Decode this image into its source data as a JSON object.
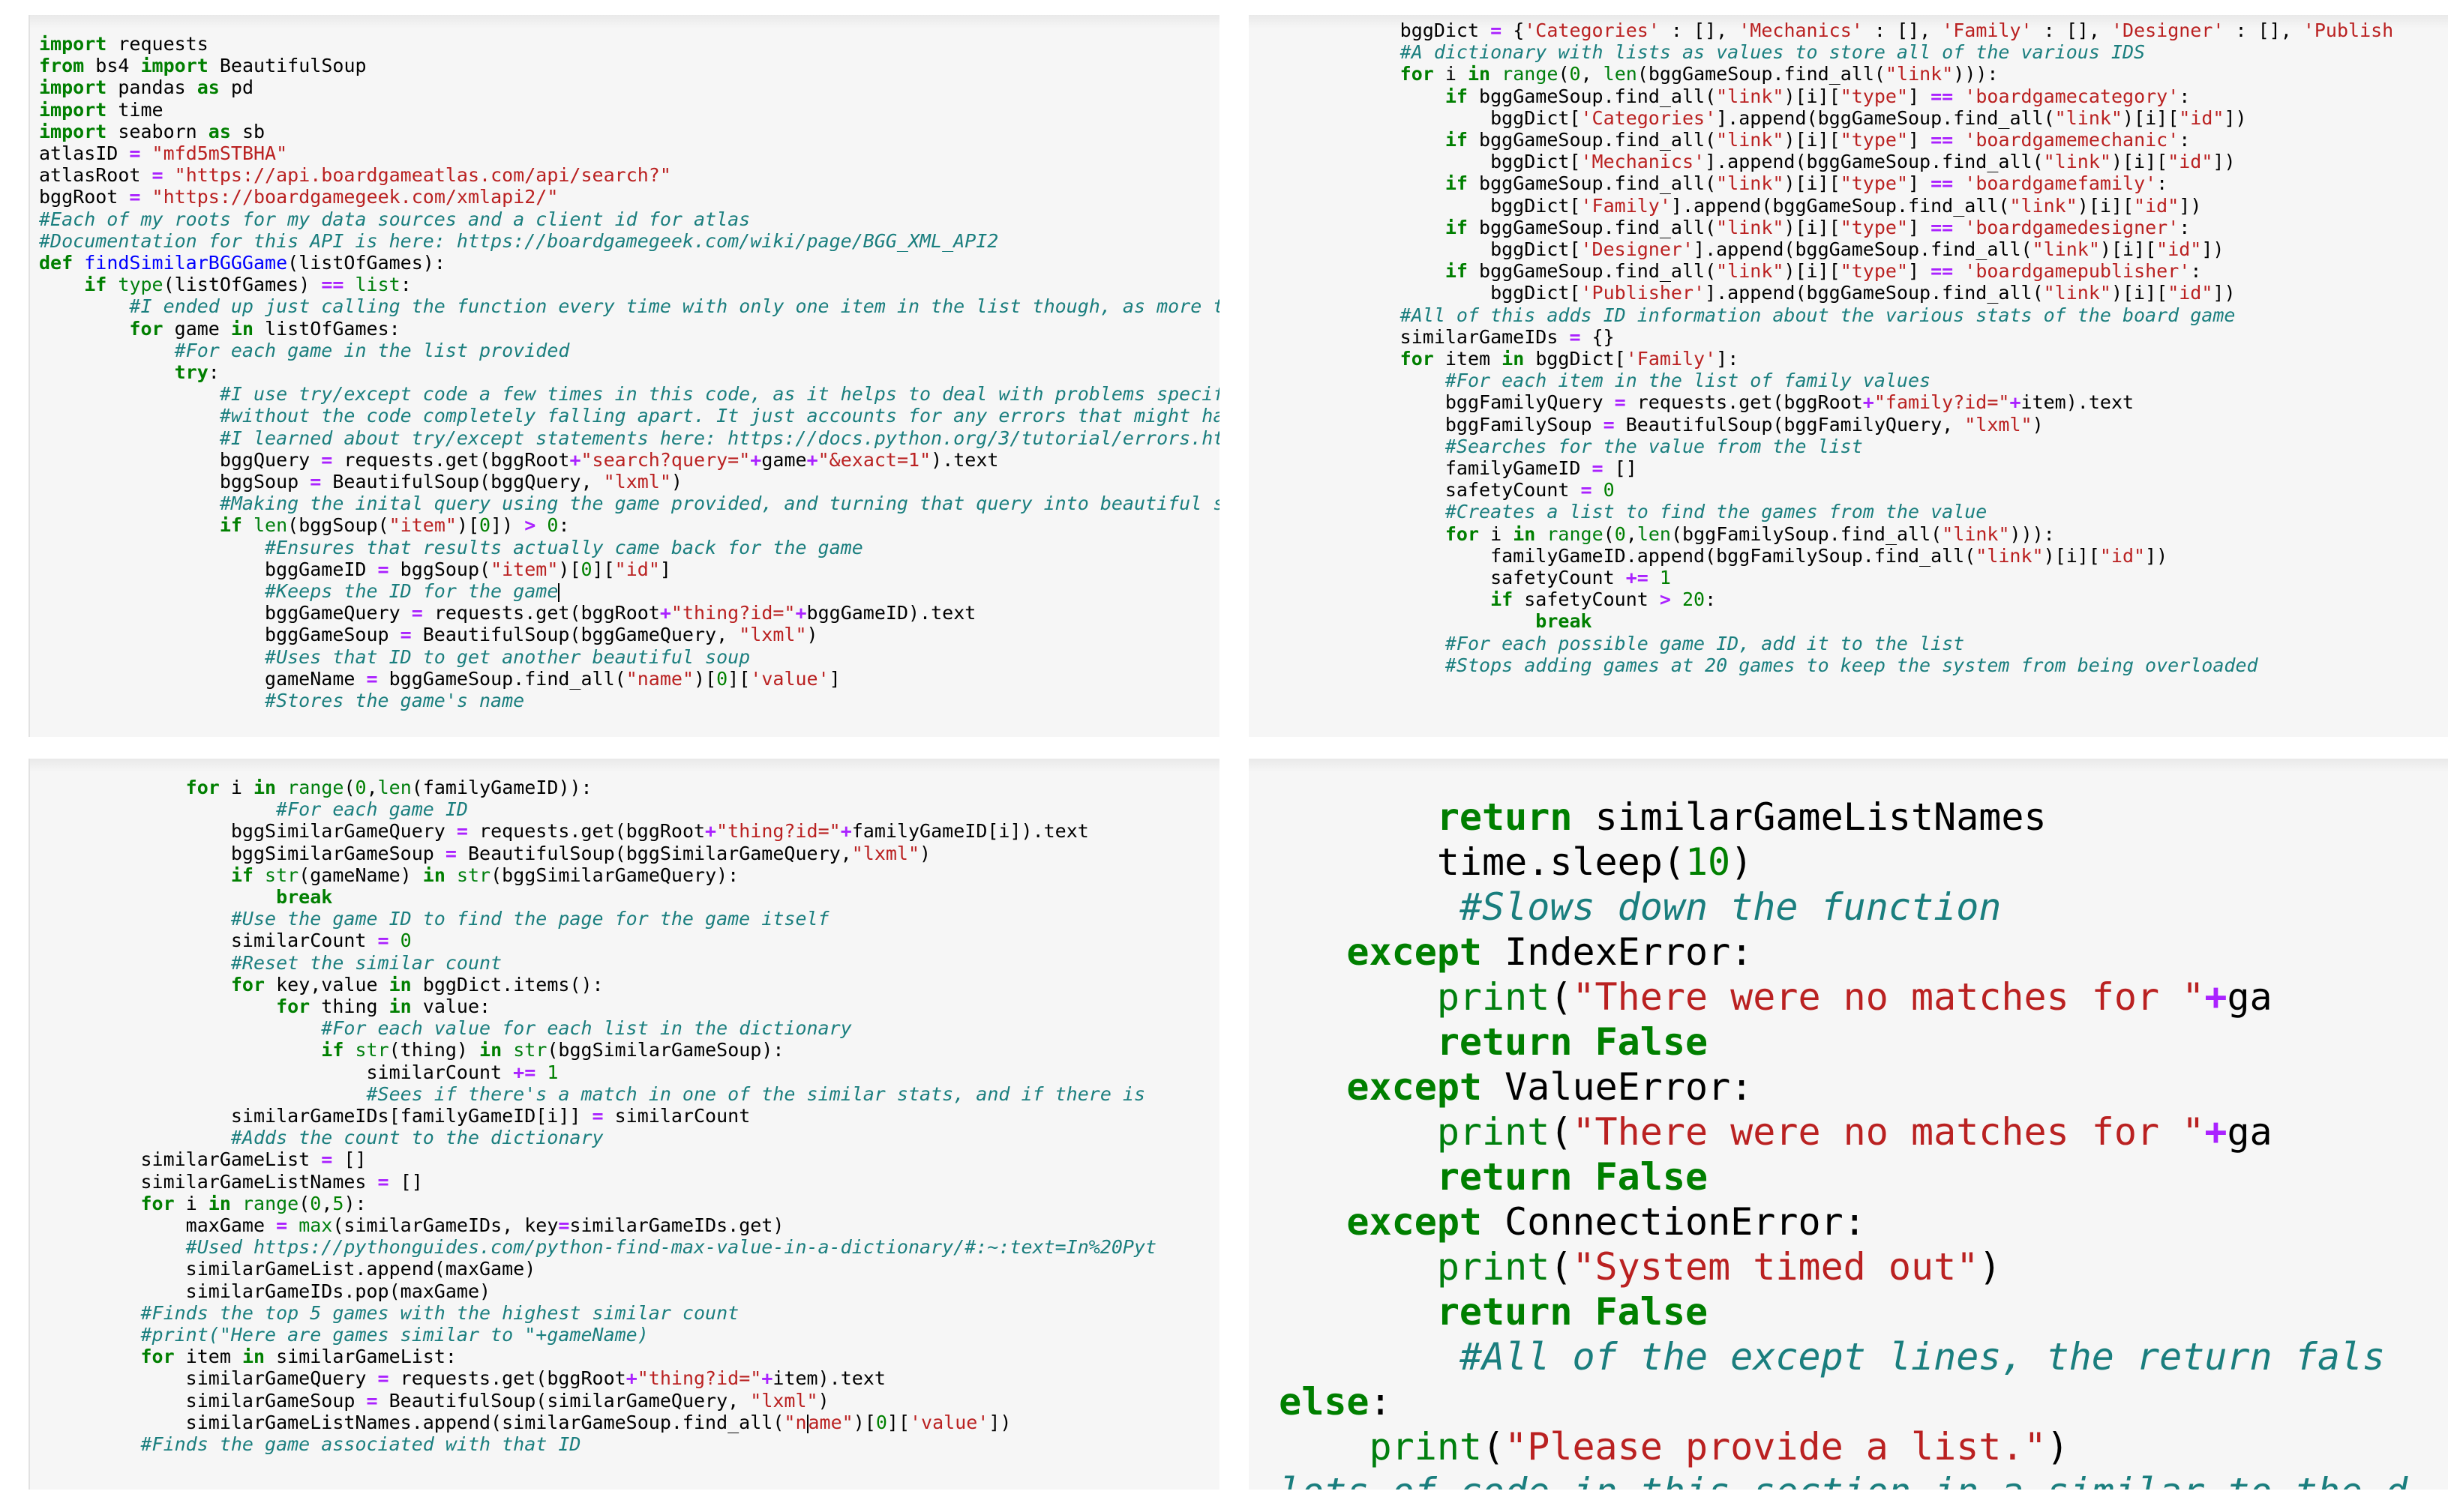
{
  "document": {
    "title": "Python code screenshots — findSimilarBGGGame",
    "layout": "2x2 grid of code screenshots",
    "background_color": "#ffffff",
    "panel_background_color": "#f6f6f6"
  },
  "theme": {
    "keyword_color": "#007f00",
    "builtin_color": "#007f0e",
    "function_name_color": "#0000ff",
    "string_color": "#ba2121",
    "comment_color": "#1a7e7e",
    "operator_color": "#aa22ff",
    "number_color": "#008000",
    "text_color": "#000000"
  },
  "panels": {
    "top_left": {
      "name": "imports-and-function-start",
      "lines": [
        "import requests",
        "from bs4 import BeautifulSoup",
        "import pandas as pd",
        "import time",
        "import seaborn as sb",
        "atlasID = \"mfd5mSTBHA\"",
        "atlasRoot = \"https://api.boardgameatlas.com/api/search?\"",
        "bggRoot = \"https://boardgamegeek.com/xmlapi2/\"",
        "#Each of my roots for my data sources and a client id for atlas",
        "#Documentation for this API is here: https://boardgamegeek.com/wiki/page/BGG_XML_API2",
        "def findSimilarBGGGame(listOfGames):",
        "    if type(listOfGames) == list:",
        "        #I ended up just calling the function every time with only one item in the list though, as more ter",
        "        for game in listOfGames:",
        "            #For each game in the list provided",
        "            try:",
        "                #I use try/except code a few times in this code, as it helps to deal with problems specific",
        "                #without the code completely falling apart. It just accounts for any errors that might happ",
        "                #I learned about try/except statements here: https://docs.python.org/3/tutorial/errors.html",
        "                bggQuery = requests.get(bggRoot+\"search?query=\"+game+\"&exact=1\").text",
        "                bggSoup = BeautifulSoup(bggQuery, \"lxml\")",
        "                #Making the inital query using the game provided, and turning that query into beautiful sou",
        "                if len(bggSoup(\"item\")[0]) > 0:",
        "                    #Ensures that results actually came back for the game",
        "                    bggGameID = bggSoup(\"item\")[0][\"id\"]",
        "                    #Keeps the ID for the game",
        "                    bggGameQuery = requests.get(bggRoot+\"thing?id=\"+bggGameID).text",
        "                    bggGameSoup = BeautifulSoup(bggGameQuery, \"lxml\")",
        "                    #Uses that ID to get another beautiful soup",
        "                    gameName = bggGameSoup.find_all(\"name\")[0]['value']",
        "                    #Stores the game's name"
      ]
    },
    "top_right": {
      "name": "dictionary-build-and-family-lookup",
      "lines": [
        "bggDict = {'Categories' : [], 'Mechanics' : [], 'Family' : [], 'Designer' : [], 'Publish",
        "#A dictionary with lists as values to store all of the various IDS",
        "for i in range(0, len(bggGameSoup.find_all(\"link\"))):",
        "    if bggGameSoup.find_all(\"link\")[i][\"type\"] == 'boardgamecategory':",
        "        bggDict['Categories'].append(bggGameSoup.find_all(\"link\")[i][\"id\"])",
        "    if bggGameSoup.find_all(\"link\")[i][\"type\"] == 'boardgamemechanic':",
        "        bggDict['Mechanics'].append(bggGameSoup.find_all(\"link\")[i][\"id\"])",
        "    if bggGameSoup.find_all(\"link\")[i][\"type\"] == 'boardgamefamily':",
        "        bggDict['Family'].append(bggGameSoup.find_all(\"link\")[i][\"id\"])",
        "    if bggGameSoup.find_all(\"link\")[i][\"type\"] == 'boardgamedesigner':",
        "        bggDict['Designer'].append(bggGameSoup.find_all(\"link\")[i][\"id\"])",
        "    if bggGameSoup.find_all(\"link\")[i][\"type\"] == 'boardgamepublisher':",
        "        bggDict['Publisher'].append(bggGameSoup.find_all(\"link\")[i][\"id\"])",
        "#All of this adds ID information about the various stats of the board game",
        "similarGameIDs = {}",
        "for item in bggDict['Family']:",
        "    #For each item in the list of family values",
        "    bggFamilyQuery = requests.get(bggRoot+\"family?id=\"+item).text",
        "    bggFamilySoup = BeautifulSoup(bggFamilyQuery, \"lxml\")",
        "    #Searches for the value from the list",
        "    familyGameID = []",
        "    safetyCount = 0",
        "    #Creates a list to find the games from the value",
        "    for i in range(0,len(bggFamilySoup.find_all(\"link\"))):",
        "        familyGameID.append(bggFamilySoup.find_all(\"link\")[i][\"id\"])",
        "        safetyCount += 1",
        "        if safetyCount > 20:",
        "            break",
        "    #For each possible game ID, add it to the list",
        "    #Stops adding games at 20 games to keep the system from being overloaded"
      ]
    },
    "bottom_left": {
      "name": "similarity-scoring-and-top-five",
      "lines": [
        "        for i in range(0,len(familyGameID)):",
        "                #For each game ID",
        "            bggSimilarGameQuery = requests.get(bggRoot+\"thing?id=\"+familyGameID[i]).text",
        "            bggSimilarGameSoup = BeautifulSoup(bggSimilarGameQuery,\"lxml\")",
        "            if str(gameName) in str(bggSimilarGameQuery):",
        "                break",
        "            #Use the game ID to find the page for the game itself",
        "            similarCount = 0",
        "            #Reset the similar count",
        "            for key,value in bggDict.items():",
        "                for thing in value:",
        "                    #For each value for each list in the dictionary",
        "                    if str(thing) in str(bggSimilarGameSoup):",
        "                        similarCount += 1",
        "                        #Sees if there's a match in one of the similar stats, and if there is",
        "            similarGameIDs[familyGameID[i]] = similarCount",
        "            #Adds the count to the dictionary",
        "    similarGameList = []",
        "    similarGameListNames = []",
        "    for i in range(0,5):",
        "        maxGame = max(similarGameIDs, key=similarGameIDs.get)",
        "        #Used https://pythonguides.com/python-find-max-value-in-a-dictionary/#:~:text=In%20Pyt",
        "        similarGameList.append(maxGame)",
        "        similarGameIDs.pop(maxGame)",
        "    #Finds the top 5 games with the highest similar count",
        "    #print(\"Here are games similar to \"+gameName)",
        "    for item in similarGameList:",
        "        similarGameQuery = requests.get(bggRoot+\"thing?id=\"+item).text",
        "        similarGameSoup = BeautifulSoup(similarGameQuery, \"lxml\")",
        "        similarGameListNames.append(similarGameSoup.find_all(\"name\")[0]['value'])",
        "    #Finds the game associated with that ID"
      ]
    },
    "bottom_right": {
      "name": "return-and-exception-handling",
      "lines": [
        "        return similarGameListNames",
        "        time.sleep(10)",
        "        #Slows down the function",
        "    except IndexError:",
        "        print(\"There were no matches for \"+ga",
        "        return False",
        "    except ValueError:",
        "        print(\"There were no matches for \"+ga",
        "        return False",
        "    except ConnectionError:",
        "        print(\"System timed out\")",
        "        return False",
        "        #All of the except lines, the return fals",
        "else:",
        "    print(\"Please provide a list.\")"
      ]
    }
  }
}
